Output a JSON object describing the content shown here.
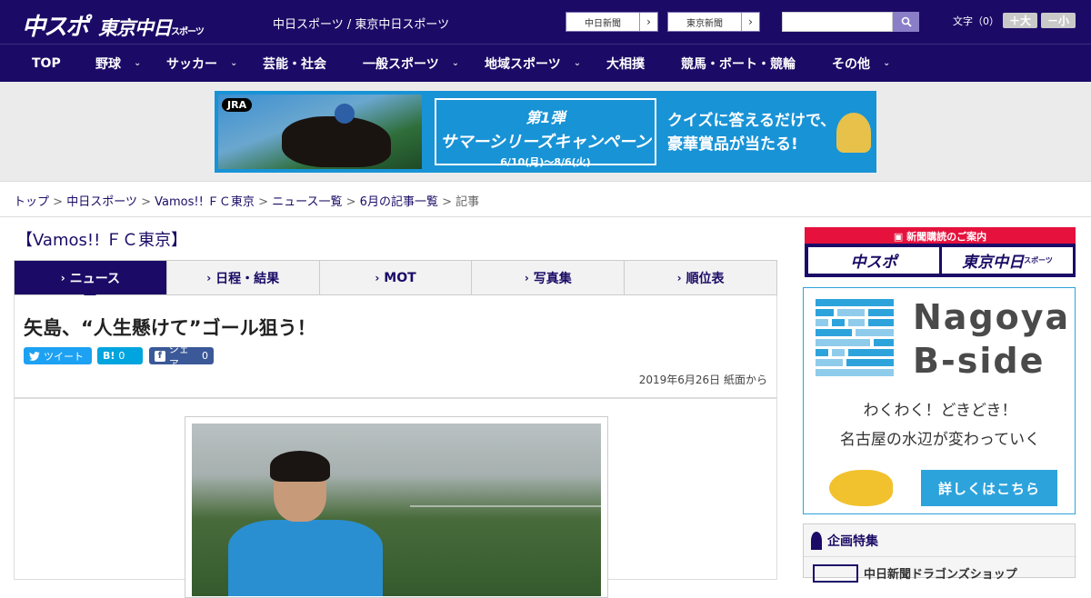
{
  "header": {
    "logo_main": "中スポ",
    "logo_tokyo": "東京中日",
    "logo_tokyo_small": "スポーツ",
    "site_links": "中日スポーツ / 東京中日スポーツ",
    "paper_links": [
      {
        "label": "中日新聞",
        "arrow": "›"
      },
      {
        "label": "東京新聞",
        "arrow": "›"
      }
    ],
    "search_placeholder": "",
    "font_size_label": "文字（0）",
    "font_plus": "＋大",
    "font_minus": "－小"
  },
  "nav": {
    "items": [
      {
        "label": "TOP",
        "chevron": ""
      },
      {
        "label": "野球",
        "chevron": "⌄"
      },
      {
        "label": "サッカー",
        "chevron": "⌄"
      },
      {
        "label": "芸能・社会",
        "chevron": ""
      },
      {
        "label": "一般スポーツ",
        "chevron": "⌄"
      },
      {
        "label": "地域スポーツ",
        "chevron": "⌄"
      },
      {
        "label": "大相撲",
        "chevron": ""
      },
      {
        "label": "競馬・ボート・競輪",
        "chevron": ""
      },
      {
        "label": "その他",
        "chevron": "⌄"
      }
    ]
  },
  "ad": {
    "brand": "JRA",
    "campaign_line1": "第1弾",
    "campaign_line2": "サマーシリーズキャンペーン",
    "campaign_dates": "6/10(月)〜8/6(火)",
    "quiz_line1": "クイズに答えるだけで、",
    "quiz_line2": "豪華賞品が当たる!"
  },
  "breadcrumb": {
    "items": [
      "トップ",
      "中日スポーツ",
      "Vamos!! ＦＣ東京",
      "ニュース一覧",
      "6月の記事一覧"
    ],
    "separator": ">",
    "current": "記事"
  },
  "section_title": "【Vamos!! ＦＣ東京】",
  "tabs": [
    {
      "label": "ニュース",
      "active": true
    },
    {
      "label": "日程・結果",
      "active": false
    },
    {
      "label": "MOT",
      "active": false
    },
    {
      "label": "写真集",
      "active": false
    },
    {
      "label": "順位表",
      "active": false
    }
  ],
  "article": {
    "headline": "矢島、“人生懸けて”ゴール狙う！",
    "share": {
      "tweet": "ツイート",
      "hatena_icon": "B!",
      "hatena_count": "0",
      "facebook_label": "シェア",
      "facebook_count": "0"
    },
    "dateline": "2019年6月26日 紙面から"
  },
  "sidebar": {
    "subscribe_label": "新聞購読のご案内",
    "subscribe_buttons": [
      {
        "main": "中スポ",
        "small": ""
      },
      {
        "main": "東京中日",
        "small": "スポーツ"
      }
    ],
    "nagoya": {
      "title_line1": "Nagoya",
      "title_line2": "B-side",
      "sub1": "わくわく！どきどき！",
      "sub2": "名古屋の水辺が変わっていく",
      "button": "詳しくはこちら"
    },
    "kikaku": {
      "title": "企画特集",
      "item": "中日新聞ドラゴンズショップ"
    }
  },
  "colors": {
    "brand_navy": "#1b0b66",
    "accent_red": "#e6123d",
    "accent_blue": "#2da3dc"
  }
}
